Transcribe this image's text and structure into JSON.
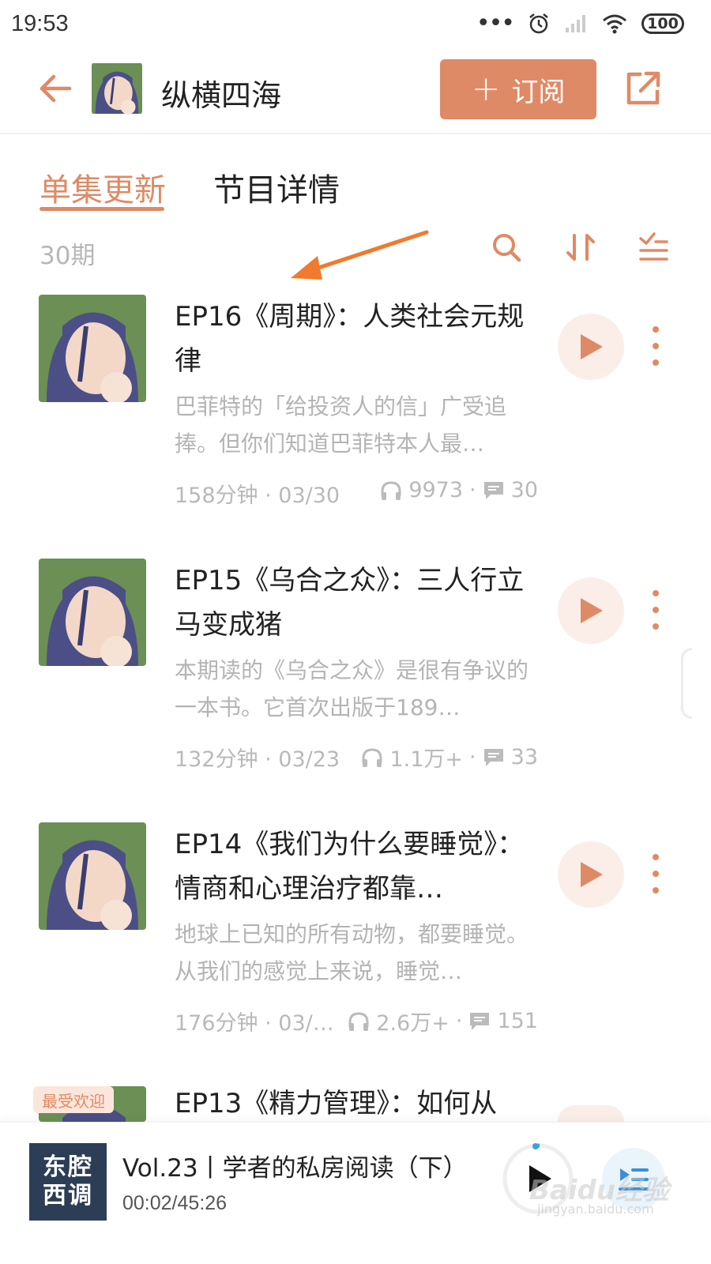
{
  "status_bar": {
    "time": "19:53",
    "battery": "100",
    "icons": [
      "more-dots-icon",
      "alarm-icon",
      "signal-icon",
      "wifi-icon",
      "battery-icon"
    ]
  },
  "header": {
    "title": "纵横四海",
    "subscribe_label": "订阅",
    "icons": [
      "back-arrow-icon",
      "share-icon"
    ]
  },
  "tabs": [
    {
      "label": "单集更新",
      "active": true
    },
    {
      "label": "节目详情",
      "active": false
    }
  ],
  "toolbar": {
    "episode_count": "30期",
    "icons": [
      "search-icon",
      "sort-icon",
      "filter-list-icon"
    ]
  },
  "episodes": [
    {
      "title": "EP16《周期》：人类社会元规律",
      "description": "巴菲特的「给投资人的信」广受追捧。但你们知道巴菲特本人最…",
      "duration_date": "158分钟 · 03/30",
      "plays": "9973",
      "comments": "30"
    },
    {
      "title": "EP15《乌合之众》：三人行立马变成猪",
      "description": "本期读的《乌合之众》是很有争议的一本书。它首次出版于189…",
      "duration_date": "132分钟 · 03/23",
      "plays": "1.1万+",
      "comments": "33"
    },
    {
      "title": "EP14《我们为什么要睡觉》：情商和心理治疗都靠…",
      "description": "地球上已知的所有动物，都要睡觉。从我们的感觉上来说，睡觉…",
      "duration_date": "176分钟 · 03/…",
      "plays": "2.6万+",
      "comments": "151"
    },
    {
      "badge": "最受欢迎",
      "title": "EP13《精力管理》：如何从"
    }
  ],
  "player": {
    "cover_line1": "东腔",
    "cover_line2": "西调",
    "title": "Vol.23丨学者的私房阅读（下）",
    "time": "00:02/45:26"
  },
  "watermark": {
    "main": "Baidu经验",
    "sub": "jingyan.baidu.com"
  },
  "colors": {
    "accent": "#df8a66",
    "annotation_arrow": "#f07a2e",
    "text_primary": "#222222",
    "text_muted": "#b4b4b4"
  }
}
